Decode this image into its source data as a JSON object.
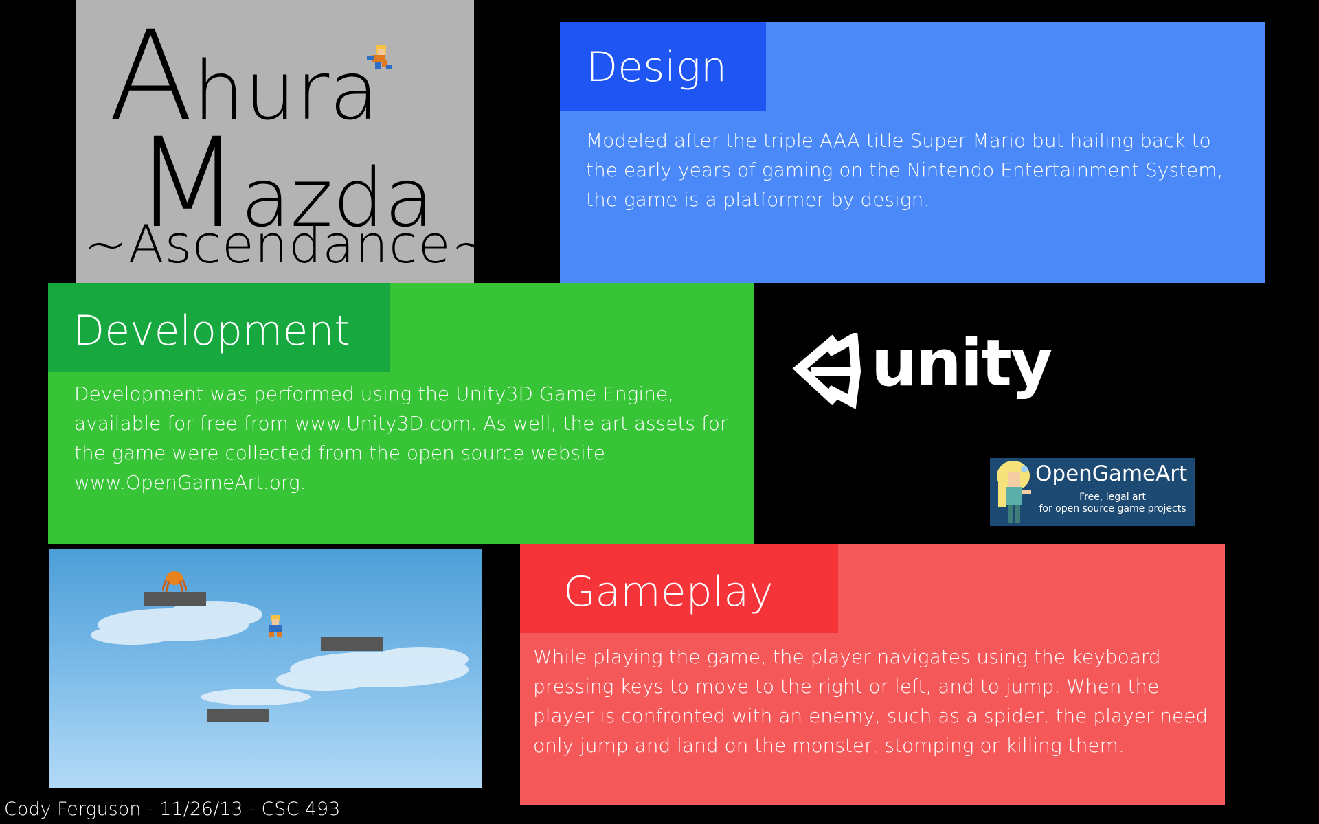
{
  "title": {
    "line1_initial": "A",
    "line1_rest": "hura",
    "line2_initial": "M",
    "line2_rest": "azda",
    "line3": "~Ascendance~"
  },
  "design": {
    "heading": "Design",
    "body": "Modeled after the triple AAA title Super Mario but hailing back to the early years of gaming on the Nintendo Entertainment System, the game is a platformer by design."
  },
  "development": {
    "heading": "Development",
    "body": "Development was performed using the Unity3D Game Engine, available for free from www.Unity3D.com. As well, the art assets for the game were collected from the open source website www.OpenGameArt.org."
  },
  "gameplay": {
    "heading": "Gameplay",
    "body": "While playing the game, the player navigates using the keyboard pressing keys to move to the right or left, and to jump. When the player is confronted with an enemy, such as a spider, the player need only jump and land on the monster, stomping or killing them."
  },
  "unity_logo": {
    "wordmark": "unity"
  },
  "opengameart": {
    "title": "OpenGameArt",
    "subtitle_line1": "Free, legal art",
    "subtitle_line2": "for open source game projects"
  },
  "footer": {
    "text": "Cody Ferguson - 11/26/13 - CSC 493"
  },
  "colors": {
    "title_panel": "#b3b3b3",
    "design_panel": "#4b89f8",
    "design_heading": "#1e55f3",
    "development_panel": "#37c437",
    "development_heading": "#17a83f",
    "gameplay_panel": "#f55859",
    "gameplay_heading": "#f5343a",
    "background": "#000000"
  }
}
